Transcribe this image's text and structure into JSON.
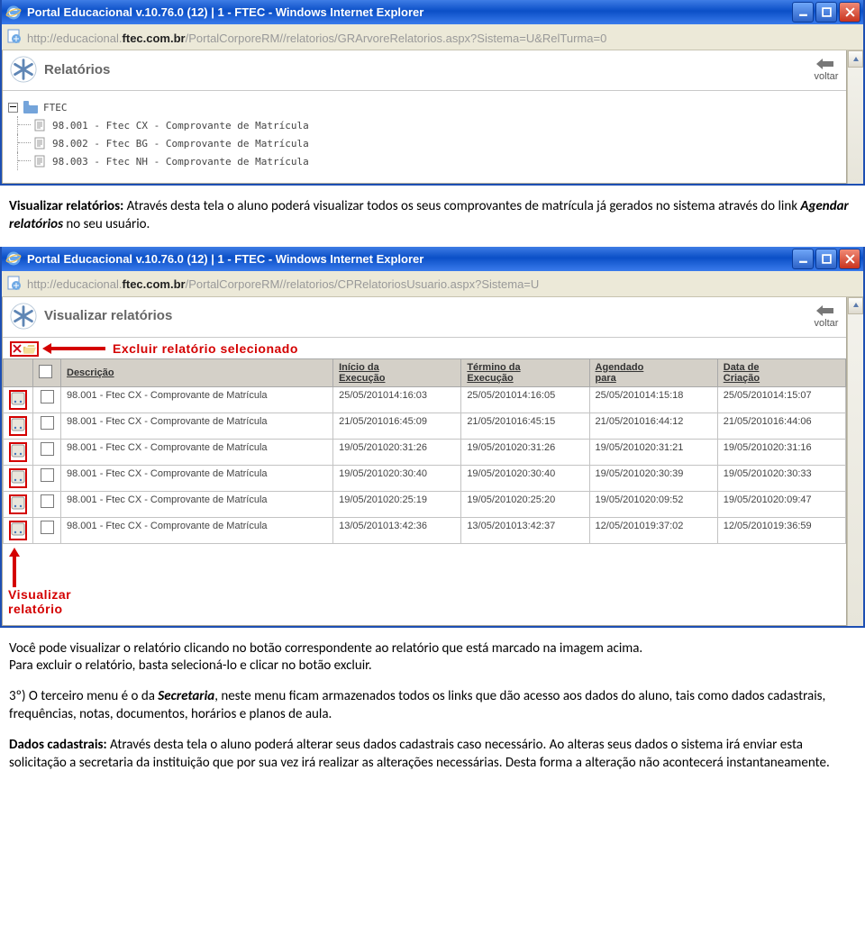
{
  "win1": {
    "title": "Portal Educacional v.10.76.0 (12) | 1 - FTEC - Windows Internet Explorer",
    "url_prefix": "http://educacional.",
    "url_bold": "ftec.com.br",
    "url_suffix": "/PortalCorporeRM//relatorios/GRArvoreRelatorios.aspx?Sistema=U&RelTurma=0",
    "header": "Relatórios",
    "voltar": "voltar",
    "tree_root": "FTEC",
    "tree_items": [
      "98.001 - Ftec CX - Comprovante de Matrícula",
      "98.002 - Ftec BG - Comprovante de Matrícula",
      "98.003 - Ftec NH - Comprovante de Matrícula"
    ]
  },
  "para1_bold": "Visualizar relatórios:",
  "para1_text": " Através desta tela o aluno poderá visualizar todos os seus comprovantes de matrícula já gerados no sistema através do link ",
  "para1_italic": "Agendar relatórios",
  "para1_tail": " no seu usuário.",
  "win2": {
    "title": "Portal Educacional v.10.76.0 (12) | 1 - FTEC - Windows Internet Explorer",
    "url_prefix": "http://educacional.",
    "url_bold": "ftec.com.br",
    "url_suffix": "/PortalCorporeRM//relatorios/CPRelatoriosUsuario.aspx?Sistema=U",
    "header": "Visualizar relatórios",
    "voltar": "voltar",
    "excluir_annot": "Excluir relatório selecionado",
    "cols": {
      "c1": "Descrição",
      "c2a": "Início da",
      "c2b": "Execução",
      "c3a": "Término da",
      "c3b": "Execução",
      "c4a": "Agendado",
      "c4b": "para",
      "c5a": "Data de",
      "c5b": "Criação"
    },
    "rows": [
      {
        "desc": "98.001 - Ftec CX - Comprovante de Matrícula",
        "c2": "25/05/2010 14:16:03",
        "c3": "25/05/2010 14:16:05",
        "c4": "25/05/2010 14:15:18",
        "c5": "25/05/2010 14:15:07"
      },
      {
        "desc": "98.001 - Ftec CX - Comprovante de Matrícula",
        "c2": "21/05/2010 16:45:09",
        "c3": "21/05/2010 16:45:15",
        "c4": "21/05/2010 16:44:12",
        "c5": "21/05/2010 16:44:06"
      },
      {
        "desc": "98.001 - Ftec CX - Comprovante de Matrícula",
        "c2": "19/05/2010 20:31:26",
        "c3": "19/05/2010 20:31:26",
        "c4": "19/05/2010 20:31:21",
        "c5": "19/05/2010 20:31:16"
      },
      {
        "desc": "98.001 - Ftec CX - Comprovante de Matrícula",
        "c2": "19/05/2010 20:30:40",
        "c3": "19/05/2010 20:30:40",
        "c4": "19/05/2010 20:30:39",
        "c5": "19/05/2010 20:30:33"
      },
      {
        "desc": "98.001 - Ftec CX - Comprovante de Matrícula",
        "c2": "19/05/2010 20:25:19",
        "c3": "19/05/2010 20:25:20",
        "c4": "19/05/2010 20:09:52",
        "c5": "19/05/2010 20:09:47"
      },
      {
        "desc": "98.001 - Ftec CX - Comprovante de Matrícula",
        "c2": "13/05/2010 13:42:36",
        "c3": "13/05/2010 13:42:37",
        "c4": "12/05/2010 19:37:02",
        "c5": "12/05/2010 19:36:59"
      }
    ],
    "viz_annot_l1": "Visualizar",
    "viz_annot_l2": "relatório"
  },
  "para2_l1": "Você pode visualizar o relatório clicando no botão correspondente ao relatório que está marcado na imagem acima.",
  "para2_l2": "Para excluir o relatório, basta selecioná-lo e clicar no botão excluir.",
  "para3_head": "3º) O terceiro menu é o da ",
  "para3_bi": "Secretaria",
  "para3_tail": ", neste menu ficam armazenados todos os links que dão acesso aos dados do aluno, tais como dados cadastrais, frequências, notas, documentos, horários e planos de aula.",
  "para4_bold": "Dados cadastrais:",
  "para4_text": " Através desta tela o aluno poderá alterar seus dados cadastrais caso necessário. Ao alteras seus dados o sistema irá enviar esta solicitação a secretaria da instituição que por sua vez irá realizar as alterações necessárias. Desta forma a alteração não acontecerá instantaneamente."
}
